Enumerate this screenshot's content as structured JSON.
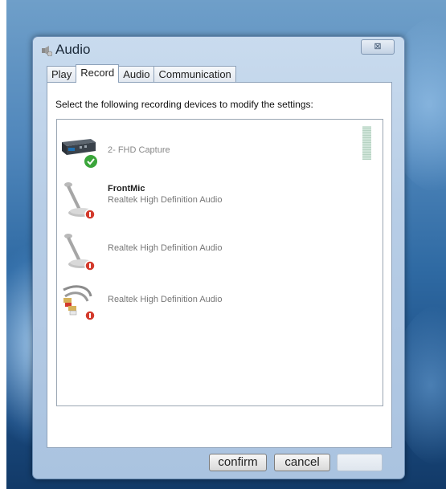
{
  "window": {
    "title": "Audio",
    "close_glyph": "⊠"
  },
  "tabs": [
    {
      "label": "Play",
      "active": false
    },
    {
      "label": "Record",
      "active": true
    },
    {
      "label": "Audio",
      "active": false
    },
    {
      "label": "Communication",
      "active": false
    }
  ],
  "instruction": "Select the following recording devices to modify the settings:",
  "devices": [
    {
      "name": "",
      "description": "2- FHD Capture",
      "icon": "capture-card-icon",
      "status": "default-check"
    },
    {
      "name": "FrontMic",
      "description": "Realtek High Definition Audio",
      "icon": "microphone-icon",
      "status": "disabled"
    },
    {
      "name": "",
      "description": "Realtek High Definition Audio",
      "icon": "microphone-icon",
      "status": "disabled"
    },
    {
      "name": "",
      "description": "Realtek High Definition Audio",
      "icon": "rca-cable-icon",
      "status": "disabled"
    }
  ],
  "buttons": {
    "confirm": "confirm",
    "cancel": "cancel"
  },
  "colors": {
    "accent_check": "#3aa53a",
    "disabled_badge": "#d33a2c"
  }
}
